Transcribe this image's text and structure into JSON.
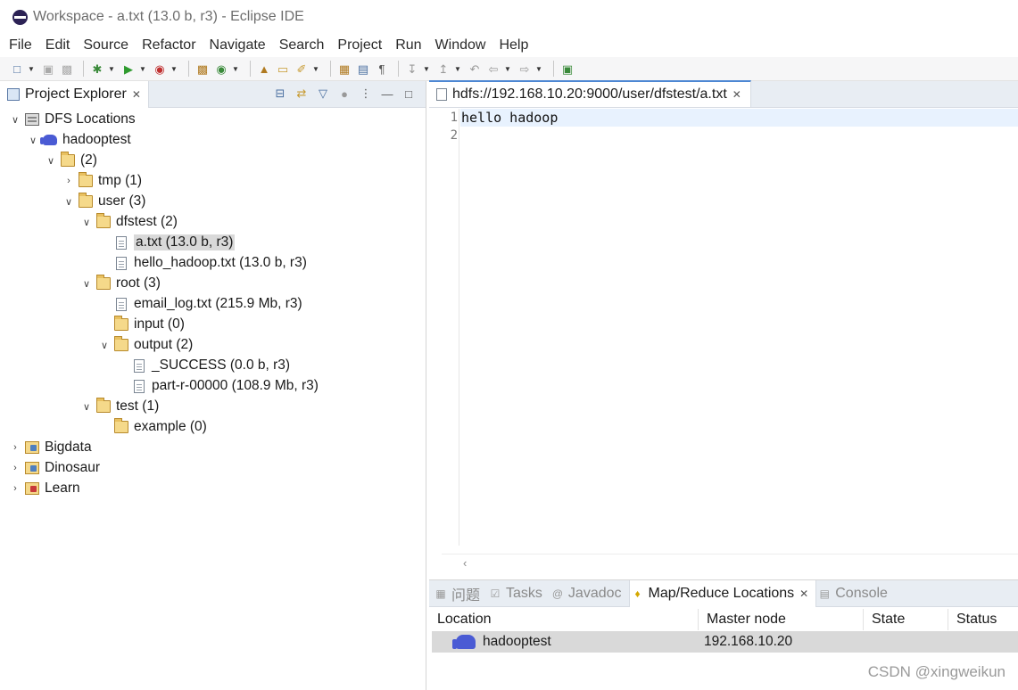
{
  "window": {
    "title": "Workspace - a.txt (13.0 b, r3) - Eclipse IDE"
  },
  "menu": [
    "File",
    "Edit",
    "Source",
    "Refactor",
    "Navigate",
    "Search",
    "Project",
    "Run",
    "Window",
    "Help"
  ],
  "project_explorer": {
    "tab_label": "Project Explorer",
    "tree": [
      {
        "label": "DFS Locations",
        "icon": "server-icon",
        "expanded": true
      },
      {
        "label": "hadooptest",
        "icon": "elephant-icon",
        "expanded": true
      },
      {
        "label": "(2)",
        "icon": "folder-icon",
        "expanded": true
      },
      {
        "label": "tmp (1)",
        "icon": "folder-icon",
        "expanded": false
      },
      {
        "label": "user (3)",
        "icon": "folder-icon",
        "expanded": true
      },
      {
        "label": "dfstest (2)",
        "icon": "folder-icon",
        "expanded": true
      },
      {
        "label": "a.txt (13.0 b, r3)",
        "icon": "file-icon",
        "selected": true
      },
      {
        "label": "hello_hadoop.txt (13.0 b, r3)",
        "icon": "file-icon"
      },
      {
        "label": "root (3)",
        "icon": "folder-icon",
        "expanded": true
      },
      {
        "label": "email_log.txt (215.9 Mb, r3)",
        "icon": "file-icon"
      },
      {
        "label": "input (0)",
        "icon": "folder-icon"
      },
      {
        "label": "output (2)",
        "icon": "folder-icon",
        "expanded": true
      },
      {
        "label": "_SUCCESS (0.0 b, r3)",
        "icon": "file-icon"
      },
      {
        "label": "part-r-00000 (108.9 Mb, r3)",
        "icon": "file-icon"
      },
      {
        "label": "test (1)",
        "icon": "folder-icon",
        "expanded": true
      },
      {
        "label": "example (0)",
        "icon": "folder-icon"
      },
      {
        "label": "Bigdata",
        "icon": "project-icon",
        "expanded": false
      },
      {
        "label": "Dinosaur",
        "icon": "project-icon",
        "expanded": false
      },
      {
        "label": "Learn",
        "icon": "project-icon",
        "expanded": false
      }
    ]
  },
  "editor": {
    "tab_label": "hdfs://192.168.10.20:9000/user/dfstest/a.txt",
    "line_numbers": [
      "1",
      "2"
    ],
    "lines": [
      "hello hadoop",
      ""
    ]
  },
  "bottom_panel": {
    "tabs": [
      {
        "label": "问题",
        "icon": "problems-icon"
      },
      {
        "label": "Tasks",
        "icon": "tasks-icon"
      },
      {
        "label": "Javadoc",
        "icon": "javadoc-icon"
      },
      {
        "label": "Map/Reduce Locations",
        "icon": "mapreduce-icon",
        "active": true
      },
      {
        "label": "Console",
        "icon": "console-icon"
      }
    ],
    "columns": [
      "Location",
      "Master node",
      "State",
      "Status"
    ],
    "rows": [
      {
        "location": "hadooptest",
        "master_node": "192.168.10.20",
        "state": "",
        "status": ""
      }
    ]
  },
  "watermark": "CSDN @xingweikun"
}
